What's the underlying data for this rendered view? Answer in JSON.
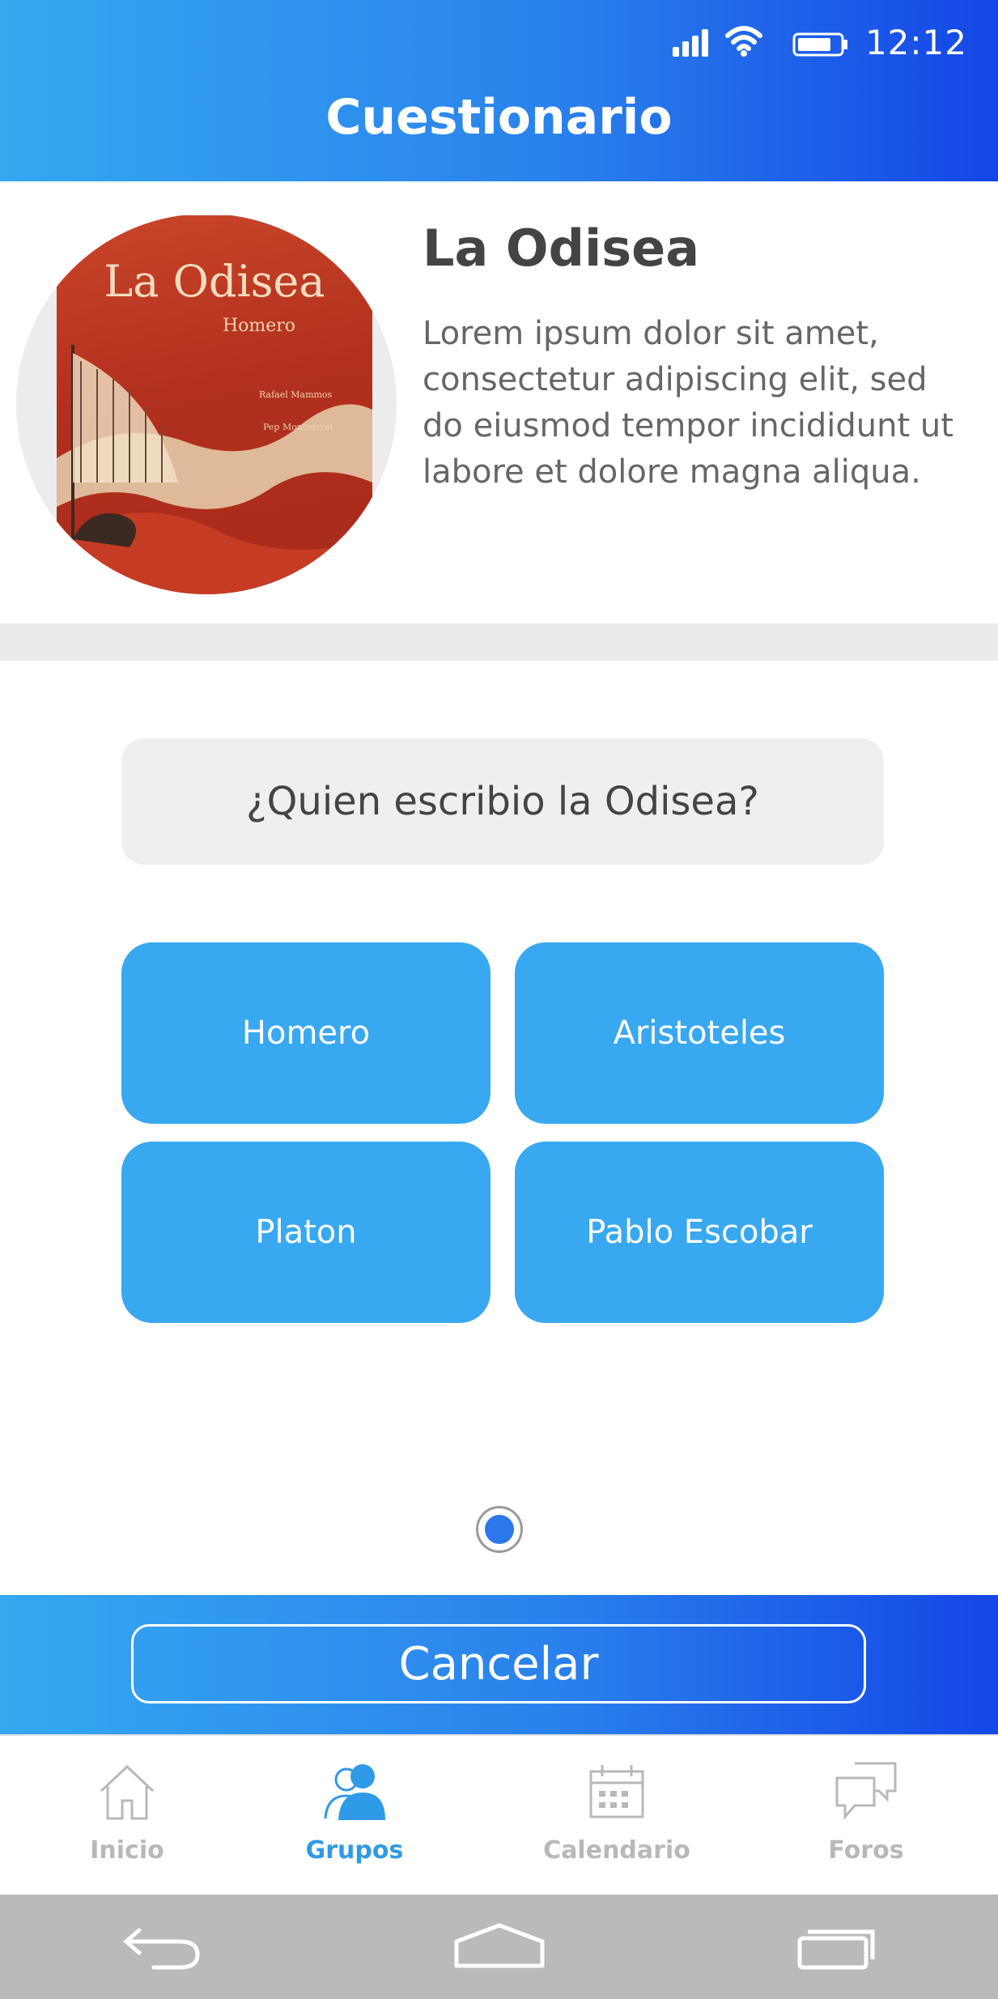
{
  "status_bar": {
    "time": "12:12",
    "icons": [
      "signal-icon",
      "wifi-icon",
      "battery-icon"
    ]
  },
  "header": {
    "title": "Cuestionario"
  },
  "book": {
    "title": "La Odisea",
    "description": "Lorem ipsum dolor sit amet, consectetur adipiscing elit, sed do eiusmod tempor incididunt ut labore et dolore magna aliqua.",
    "cover": {
      "title": "La Odisea",
      "author": "Homero"
    }
  },
  "quiz": {
    "question": "¿Quien escribio la Odisea?",
    "answers": [
      "Homero",
      "Aristoteles",
      "Platon",
      "Pablo Escobar"
    ]
  },
  "actions": {
    "cancel_label": "Cancelar"
  },
  "tabs": [
    {
      "label": "Inicio",
      "icon": "home-icon",
      "active": false
    },
    {
      "label": "Grupos",
      "icon": "group-icon",
      "active": true
    },
    {
      "label": "Calendario",
      "icon": "calendar-icon",
      "active": false
    },
    {
      "label": "Foros",
      "icon": "forum-icon",
      "active": false
    }
  ],
  "colors": {
    "accent": "#38a8f0",
    "header_start": "#35a8f0",
    "header_end": "#1446e6",
    "active_tab": "#2f9ae8"
  }
}
